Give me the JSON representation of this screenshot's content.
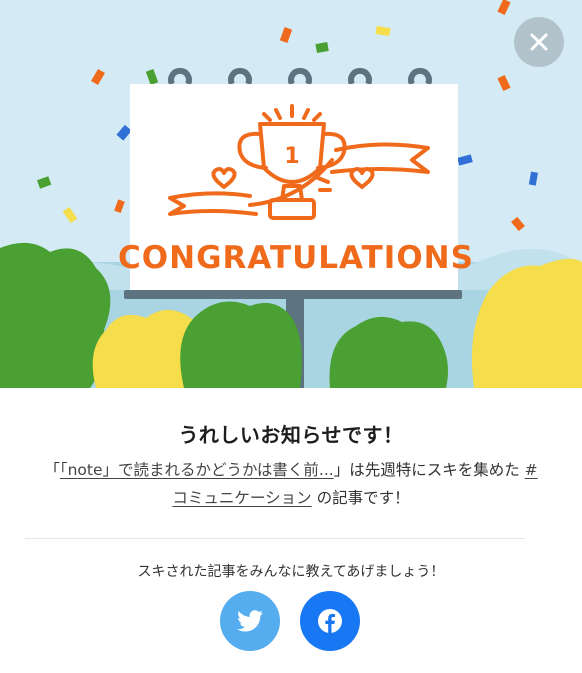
{
  "illustration": {
    "banner_text": "CONGRATULATIONS",
    "trophy_number": "1"
  },
  "modal": {
    "title": "うれしいお知らせです！",
    "message_prefix": "「",
    "article_link": "「note」で読まれるかどうかは書く前...",
    "message_middle": "」は先週特にスキを集めた",
    "hashtag_link": "#コミュニケーション",
    "message_suffix": "の記事です！",
    "share_prompt": "スキされた記事をみんなに教えてあげましょう！"
  },
  "icons": {
    "close": "close-icon",
    "twitter": "twitter-icon",
    "facebook": "facebook-icon"
  },
  "colors": {
    "sky": "#d4ebf5",
    "orange": "#f06a1c",
    "green": "#4aa032",
    "yellow": "#f6dd4c",
    "billboard_pole": "#5d7380",
    "twitter": "#55acee",
    "facebook": "#1877f2",
    "close_button": "#b2c2ca"
  }
}
